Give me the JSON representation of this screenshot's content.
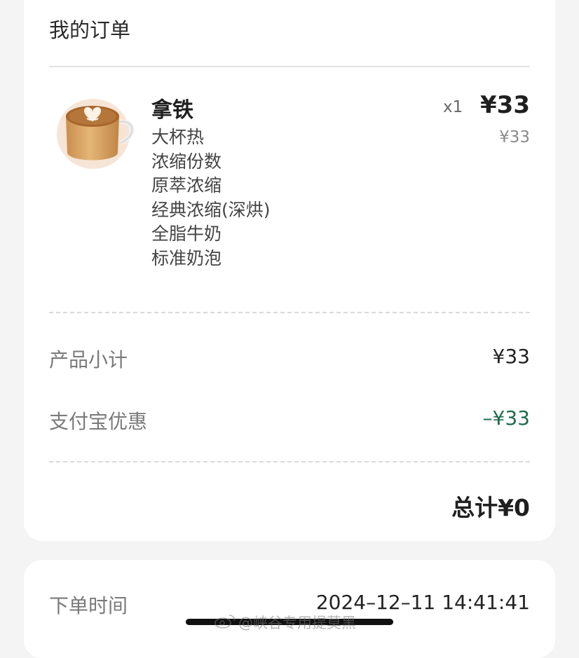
{
  "order": {
    "title": "我的订单",
    "item": {
      "name": "拿铁",
      "quantity": "x1",
      "price": "¥33",
      "original_price": "¥33",
      "image_icon": "latte-cup-icon",
      "options": [
        "大杯热",
        "浓缩份数",
        "原萃浓缩",
        "经典浓缩(深烘)",
        "全脂牛奶",
        "标准奶泡"
      ]
    },
    "subtotal": {
      "label": "产品小计",
      "value": "¥33"
    },
    "discount": {
      "label": "支付宝优惠",
      "value": "–¥33"
    },
    "total": "总计¥0"
  },
  "order_time": {
    "label": "下单时间",
    "value": "2024–12–11 14:41:41"
  },
  "watermark": "@峡谷专用提莫黑",
  "colors": {
    "background": "#f4f4f4",
    "card": "#ffffff",
    "discount_green": "#1e6b4b",
    "muted_text": "#7a7a7a"
  }
}
